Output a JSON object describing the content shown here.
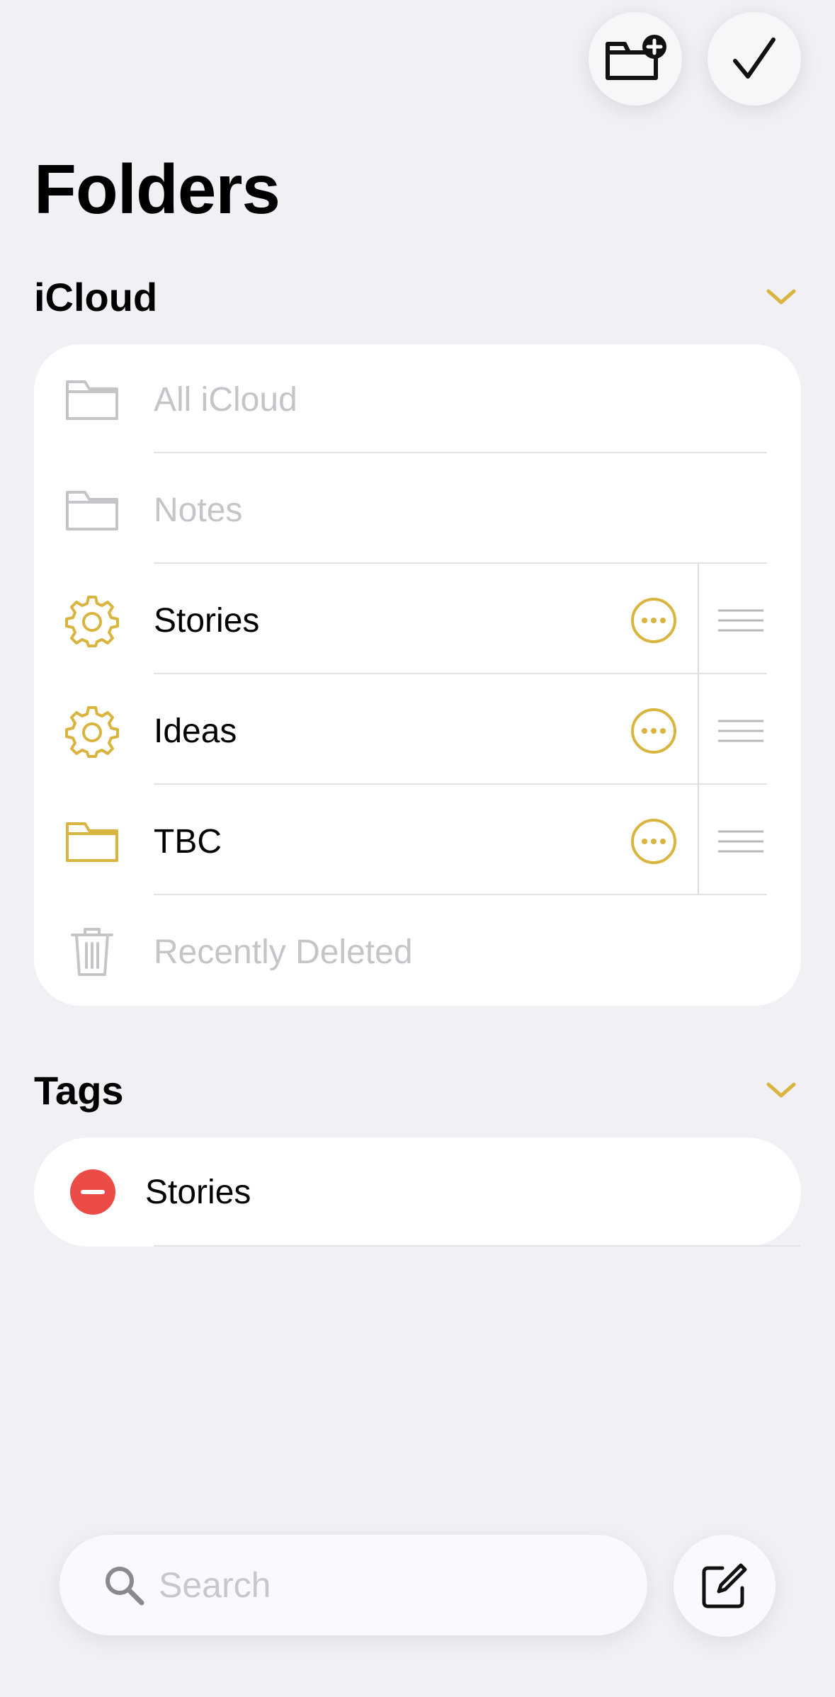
{
  "header": {
    "title": "Folders",
    "new_folder_icon": "folder-badge-plus-icon",
    "done_icon": "checkmark-icon"
  },
  "icloud": {
    "section_label": "iCloud",
    "collapse_icon": "chevron-down-icon",
    "folders": [
      {
        "label": "All iCloud",
        "icon": "folder-icon",
        "editable": false
      },
      {
        "label": "Notes",
        "icon": "folder-icon",
        "editable": false
      },
      {
        "label": "Stories",
        "icon": "gear-icon",
        "editable": true
      },
      {
        "label": "Ideas",
        "icon": "gear-icon",
        "editable": true
      },
      {
        "label": "TBC",
        "icon": "folder-icon",
        "editable": true
      },
      {
        "label": "Recently Deleted",
        "icon": "trash-icon",
        "editable": false
      }
    ]
  },
  "tags": {
    "section_label": "Tags",
    "collapse_icon": "chevron-down-icon",
    "items": [
      {
        "label": "Stories",
        "icon": "minus-circle-icon"
      }
    ]
  },
  "bottom_bar": {
    "search_placeholder": "Search",
    "search_value": "",
    "compose_icon": "compose-icon"
  },
  "colors": {
    "accent": "#d9b43e",
    "delete": "#ec4c47",
    "background": "#f0f0f5",
    "disabled_text": "#c4c4c9"
  }
}
